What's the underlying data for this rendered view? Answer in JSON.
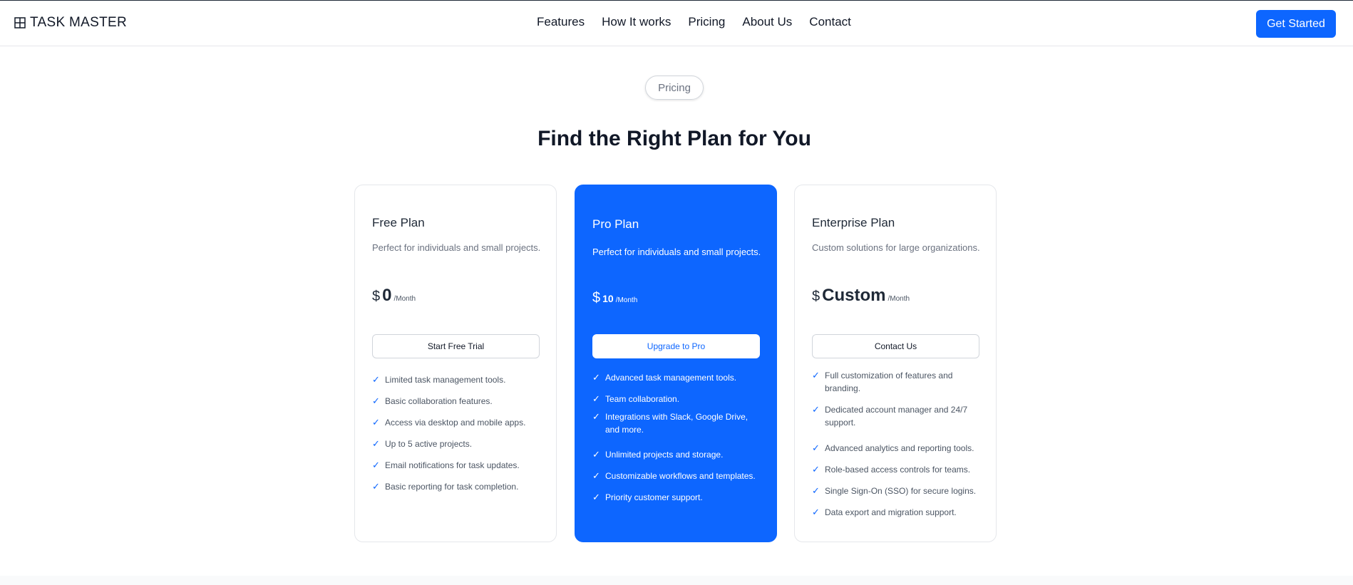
{
  "navbar": {
    "logo_text": "TASK MASTER",
    "links": [
      "Features",
      "How It works",
      "Pricing",
      "About Us",
      "Contact"
    ],
    "cta_label": "Get Started",
    "accent": "#0d66ff"
  },
  "section": {
    "tag": "Pricing",
    "heading": "Find the Right Plan for You"
  },
  "plans": [
    {
      "name": "Free Plan",
      "description": "Perfect for individuals and small projects.",
      "currency": "$",
      "price": "0",
      "period": "/Month",
      "button": "Start Free Trial",
      "features": [
        "Limited task management tools.",
        "Basic collaboration features.",
        "Access via desktop and mobile apps.",
        "Up to 5 active projects.",
        "Email notifications for task updates.",
        "Basic reporting for task completion."
      ]
    },
    {
      "name": "Pro Plan",
      "description": "Perfect for individuals and small projects.",
      "currency": "$",
      "price": "10",
      "period": "/Month",
      "button": "Upgrade to Pro",
      "features": [
        "Advanced task management tools.",
        "Team collaboration.",
        "Integrations with Slack, Google Drive, and more.",
        "Unlimited projects and storage.",
        "Customizable workflows and templates.",
        "Priority customer support."
      ]
    },
    {
      "name": "Enterprise Plan",
      "description": "Custom solutions for large organizations.",
      "currency": "$",
      "price": "Custom",
      "period": "/Month",
      "button": "Contact Us",
      "features": [
        "Full customization of features and branding.",
        "Dedicated account manager and 24/7 support.",
        "Advanced analytics and reporting tools.",
        "Role-based access controls for teams.",
        "Single Sign-On (SSO) for secure logins.",
        "Data export and migration support."
      ]
    }
  ],
  "icons": {
    "logo": "grid-icon",
    "feature": "checkmark-icon"
  }
}
